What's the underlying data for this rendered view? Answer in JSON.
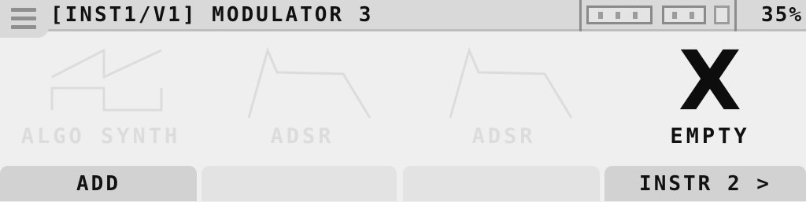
{
  "header": {
    "title": "[INST1/V1] MODULATOR 3",
    "battery_percent": "35%",
    "battery_level": 0.35,
    "menu_icon": "hamburger-menu-icon"
  },
  "slots": [
    {
      "label": "ALGO SYNTH",
      "icon": "algo-synth-waveform-icon",
      "active": false
    },
    {
      "label": "ADSR",
      "icon": "adsr-envelope-icon",
      "active": false
    },
    {
      "label": "ADSR",
      "icon": "adsr-envelope-icon",
      "active": false
    },
    {
      "label": "EMPTY",
      "icon": "empty-x-icon",
      "glyph": "X",
      "active": true
    }
  ],
  "buttons": {
    "add": "ADD",
    "blank_2": "",
    "blank_3": "",
    "next": "INSTR 2 >"
  },
  "colors": {
    "background": "#efefef",
    "header": "#d9d9d9",
    "inactive_text": "#dcdcdc",
    "active_text": "#111111",
    "button": "#e3e3e3"
  }
}
